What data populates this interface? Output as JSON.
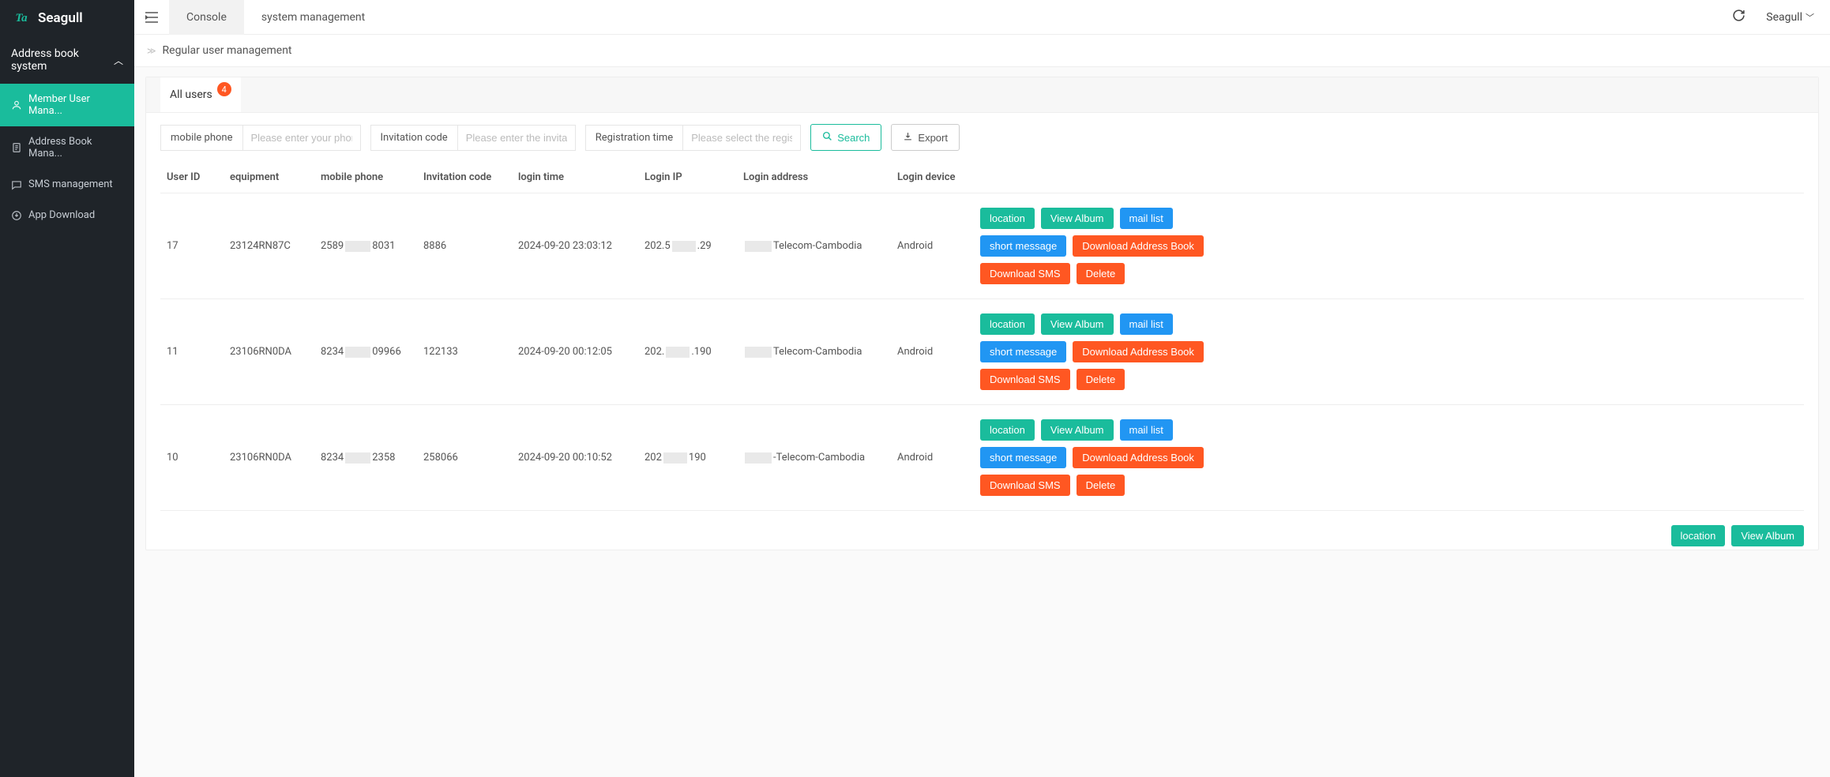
{
  "brand": {
    "logo_text": "Seagull",
    "logo_mark": "Ta"
  },
  "sidebar": {
    "group_label": "Address book system",
    "items": [
      {
        "label": "Member User Mana...",
        "icon": "user-icon",
        "active": true
      },
      {
        "label": "Address Book Mana...",
        "icon": "doc-icon",
        "active": false
      },
      {
        "label": "SMS management",
        "icon": "sms-icon",
        "active": false
      },
      {
        "label": "App Download",
        "icon": "download-icon",
        "active": false
      }
    ]
  },
  "top_tabs": [
    {
      "label": "Console",
      "active": true
    },
    {
      "label": "system management",
      "active": false
    }
  ],
  "topbar": {
    "user_label": "Seagull"
  },
  "breadcrumb": {
    "current": "Regular user management"
  },
  "card_tabs": {
    "all_users_label": "All users",
    "badge_count": "4"
  },
  "filters": {
    "mobile_label": "mobile phone",
    "mobile_placeholder": "Please enter your phone",
    "invite_label": "Invitation code",
    "invite_placeholder": "Please enter the invitatio",
    "reg_label": "Registration time",
    "reg_placeholder": "Please select the registr",
    "search_label": "Search",
    "export_label": "Export"
  },
  "table": {
    "columns": [
      "User ID",
      "equipment",
      "mobile phone",
      "Invitation code",
      "login time",
      "Login IP",
      "Login address",
      "Login device"
    ],
    "rows": [
      {
        "id": "17",
        "equipment": "23124RN87C",
        "phone_pre": "2589",
        "phone_post": "8031",
        "invite": "8886",
        "login": "2024-09-20 23:03:12",
        "ip_pre": "202.5",
        "ip_post": ".29",
        "addr_post": "Telecom-Cambodia",
        "device": "Android"
      },
      {
        "id": "11",
        "equipment": "23106RN0DA",
        "phone_pre": "8234",
        "phone_post": "09966",
        "invite": "122133",
        "login": "2024-09-20 00:12:05",
        "ip_pre": "202.",
        "ip_post": ".190",
        "addr_post": "Telecom-Cambodia",
        "device": "Android"
      },
      {
        "id": "10",
        "equipment": "23106RN0DA",
        "phone_pre": "8234",
        "phone_post": "2358",
        "invite": "258066",
        "login": "2024-09-20 00:10:52",
        "ip_pre": "202",
        "ip_post": "190",
        "addr_post": "-Telecom-Cambodia",
        "device": "Android"
      }
    ],
    "actions": {
      "location": "location",
      "view_album": "View Album",
      "mail_list": "mail list",
      "short_message": "short message",
      "dl_addr": "Download Address Book",
      "dl_sms": "Download SMS",
      "delete": "Delete"
    }
  }
}
